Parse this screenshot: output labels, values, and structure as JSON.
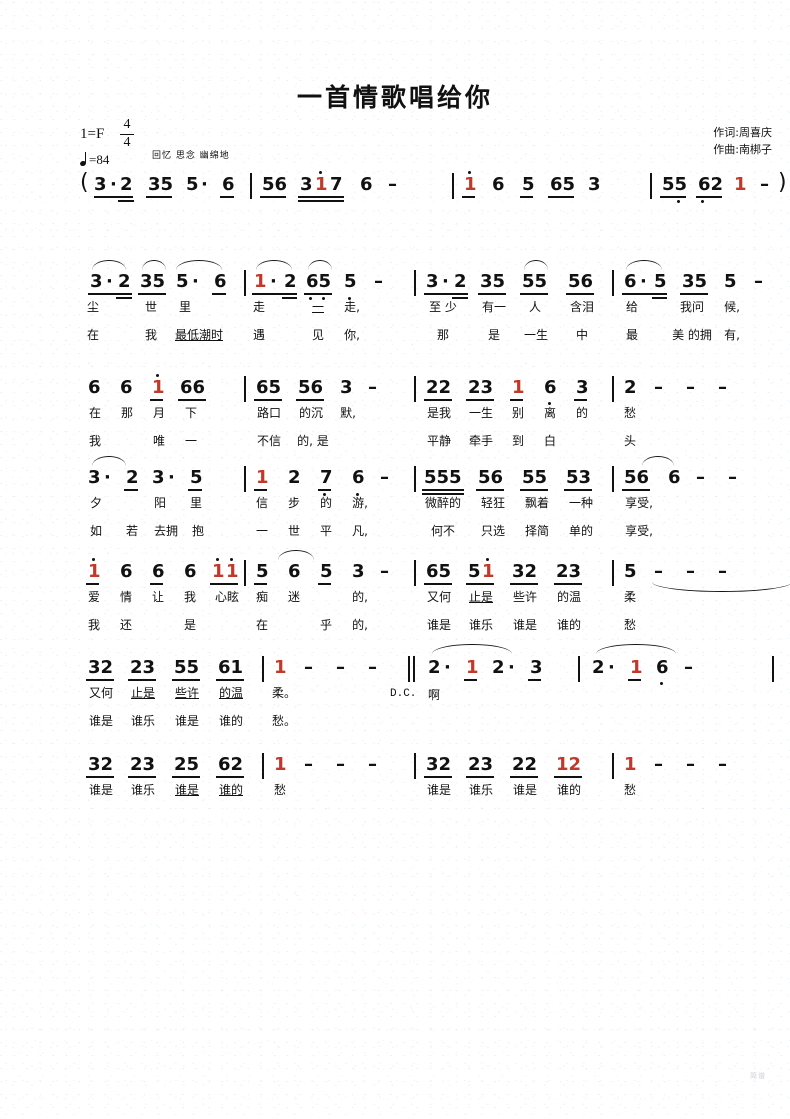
{
  "document": {
    "title": "一首情歌唱给你",
    "key_signature": "1=F",
    "meter_numerator": "4",
    "meter_denominator": "4",
    "tempo_value": "=84",
    "expression": "回忆 思念 幽绵地",
    "lyricist_credit": "作词:周喜庆",
    "composer_credit": "作曲:南梆子",
    "repeat_mark": "D.C.",
    "open_paren": "(",
    "close_paren": ")",
    "watermark": "简谱"
  },
  "chart_data": {
    "type": "table",
    "title": "一首情歌唱给你 — 简谱 (Chinese numbered notation)",
    "key": "1=F",
    "time_signature": "4/4",
    "tempo_bpm": 84,
    "expression_marking": "回忆 思念 幽绵地",
    "systems": [
      {
        "index": 0,
        "label": "intro",
        "measures": [
          {
            "notes": "3·2 35 5· 6",
            "lyrics_1": "",
            "lyrics_2": ""
          },
          {
            "notes": "56 3i7 6 -",
            "lyrics_1": "",
            "lyrics_2": ""
          },
          {
            "notes": "i 6 5 65 3",
            "lyrics_1": "",
            "lyrics_2": ""
          },
          {
            "notes": "55 62 1 -",
            "lyrics_1": "",
            "lyrics_2": ""
          }
        ]
      },
      {
        "index": 1,
        "label": "verse-line-1",
        "measures": [
          {
            "notes": "3·2 35 5· 6",
            "lyrics_1": "尘 世 里",
            "lyrics_2": "在 我 最低潮时"
          },
          {
            "notes": "1·2 65 5 -",
            "lyrics_1": "走 一 走,",
            "lyrics_2": "遇 见 你,"
          },
          {
            "notes": "3·2 35 55 56",
            "lyrics_1": "至少 有一 人 含泪",
            "lyrics_2": "那 是 一生 中"
          },
          {
            "notes": "6·5 35 5 -",
            "lyrics_1": "给 我问 候,",
            "lyrics_2": "最 美 的拥 有,"
          }
        ]
      },
      {
        "index": 2,
        "label": "verse-line-2",
        "measures": [
          {
            "notes": "6 6 i 66",
            "lyrics_1": "在 那 月 下",
            "lyrics_2": "我 唯 一"
          },
          {
            "notes": "65 56 3 -",
            "lyrics_1": "路口 的沉 默,",
            "lyrics_2": "不信 的, 是"
          },
          {
            "notes": "22 23 1 6 3",
            "lyrics_1": "是我 一生 别 离 的",
            "lyrics_2": "平静 牵手 到 白"
          },
          {
            "notes": "2 - - - -",
            "lyrics_1": "愁",
            "lyrics_2": "头"
          }
        ]
      },
      {
        "index": 3,
        "label": "verse-line-3",
        "measures": [
          {
            "notes": "3· 2 3· 5",
            "lyrics_1": "夕 阳 里",
            "lyrics_2": "如 若 去拥 抱"
          },
          {
            "notes": "1 2 7 6 -",
            "lyrics_1": "信 步 的 游,",
            "lyrics_2": "一 世 平 凡,"
          },
          {
            "notes": "555 56 55 53",
            "lyrics_1": "微醉的 轻狂 飘着 一种",
            "lyrics_2": "何不 只选 择简 单的"
          },
          {
            "notes": "56 6 - -",
            "lyrics_1": "享受,",
            "lyrics_2": "享受,"
          }
        ]
      },
      {
        "index": 4,
        "label": "verse-line-4",
        "measures": [
          {
            "notes": "i 6 6 6 ii",
            "lyrics_1": "爱 情 让 我 心眩",
            "lyrics_2": "我 还 是"
          },
          {
            "notes": "5 6 5 3 -",
            "lyrics_1": "痴 迷 的,",
            "lyrics_2": "在 乎 的,"
          },
          {
            "notes": "65 5i 32 23",
            "lyrics_1": "又何 止是 些许 的温",
            "lyrics_2": "谁是 谁乐 谁是 谁的"
          },
          {
            "notes": "5 - - - -",
            "lyrics_1": "柔",
            "lyrics_2": "愁"
          }
        ]
      },
      {
        "index": 5,
        "label": "verse-line-5",
        "measures": [
          {
            "notes": "32 23 55 61",
            "lyrics_1": "又何 止是 些许 的温",
            "lyrics_2": "谁是 谁乐 谁是 谁的"
          },
          {
            "notes": "1 - - - -",
            "lyrics_1": "柔。",
            "lyrics_2": "愁。"
          },
          {
            "notes": "2· 1 2· 3",
            "lyrics_1": "啊",
            "lyrics_2": ""
          },
          {
            "notes": "2· 1 6 -",
            "lyrics_1": "",
            "lyrics_2": ""
          }
        ]
      },
      {
        "index": 6,
        "label": "coda",
        "measures": [
          {
            "notes": "32 23 25 62",
            "lyrics_1": "谁是 谁乐 谁是 谁的",
            "lyrics_2": ""
          },
          {
            "notes": "1 - - - -",
            "lyrics_1": "愁",
            "lyrics_2": ""
          },
          {
            "notes": "32 23 22 12",
            "lyrics_1": "谁是 谁乐 谁是 谁的",
            "lyrics_2": ""
          },
          {
            "notes": "1 - - - -",
            "lyrics_1": "愁",
            "lyrics_2": ""
          }
        ]
      }
    ],
    "notes_glyphs": {
      "intro_m1": [
        "3",
        "·",
        "2",
        "35",
        "5",
        "·",
        "6"
      ],
      "intro_m2": [
        "56",
        "3",
        "i",
        "7",
        "6",
        "–"
      ],
      "intro_m3": [
        "i",
        "6",
        "5",
        "65",
        "3"
      ],
      "intro_m4": [
        "55",
        "62",
        "1",
        "–"
      ]
    }
  },
  "lines": [
    {
      "id": "intro",
      "cells": [
        {
          "t": "3",
          "sub": "·2",
          "ly1": "",
          "ly2": ""
        },
        {
          "t": "35",
          "ly1": "",
          "ly2": ""
        },
        {
          "t": "5·",
          "ly1": "",
          "ly2": ""
        },
        {
          "t": "6",
          "ly1": "",
          "ly2": ""
        }
      ]
    }
  ]
}
